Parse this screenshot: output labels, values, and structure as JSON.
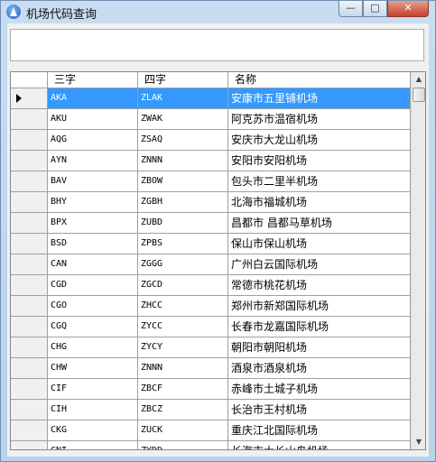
{
  "window": {
    "title": "机场代码查询",
    "min_label": "—",
    "max_label": "□",
    "close_label": "✕"
  },
  "search": {
    "value": ""
  },
  "grid": {
    "columns": [
      "三字",
      "四字",
      "名称"
    ],
    "selected_row": 0,
    "rows": [
      {
        "iata": "AKA",
        "icao": "ZLAK",
        "name": "安康市五里铺机场"
      },
      {
        "iata": "AKU",
        "icao": "ZWAK",
        "name": "阿克苏市温宿机场"
      },
      {
        "iata": "AQG",
        "icao": "ZSAQ",
        "name": "安庆市大龙山机场"
      },
      {
        "iata": "AYN",
        "icao": "ZNNN",
        "name": "安阳市安阳机场"
      },
      {
        "iata": "BAV",
        "icao": "ZBOW",
        "name": "包头市二里半机场"
      },
      {
        "iata": "BHY",
        "icao": "ZGBH",
        "name": "北海市福城机场"
      },
      {
        "iata": "BPX",
        "icao": "ZUBD",
        "name": "昌都市 昌都马草机场"
      },
      {
        "iata": "BSD",
        "icao": "ZPBS",
        "name": "保山市保山机场"
      },
      {
        "iata": "CAN",
        "icao": "ZGGG",
        "name": "广州白云国际机场"
      },
      {
        "iata": "CGD",
        "icao": "ZGCD",
        "name": "常德市桃花机场"
      },
      {
        "iata": "CGO",
        "icao": "ZHCC",
        "name": "郑州市新郑国际机场"
      },
      {
        "iata": "CGQ",
        "icao": "ZYCC",
        "name": "长春市龙嘉国际机场"
      },
      {
        "iata": "CHG",
        "icao": "ZYCY",
        "name": "朝阳市朝阳机场"
      },
      {
        "iata": "CHW",
        "icao": "ZNNN",
        "name": "酒泉市酒泉机场"
      },
      {
        "iata": "CIF",
        "icao": "ZBCF",
        "name": "赤峰市土城子机场"
      },
      {
        "iata": "CIH",
        "icao": "ZBCZ",
        "name": "长治市王村机场"
      },
      {
        "iata": "CKG",
        "icao": "ZUCK",
        "name": "重庆江北国际机场"
      },
      {
        "iata": "CNI",
        "icao": "ZYDD",
        "name": "长海市大长山岛机场"
      }
    ]
  },
  "icons": {
    "app": "airport-app-icon",
    "scroll_up": "▲",
    "scroll_down": "▼"
  }
}
